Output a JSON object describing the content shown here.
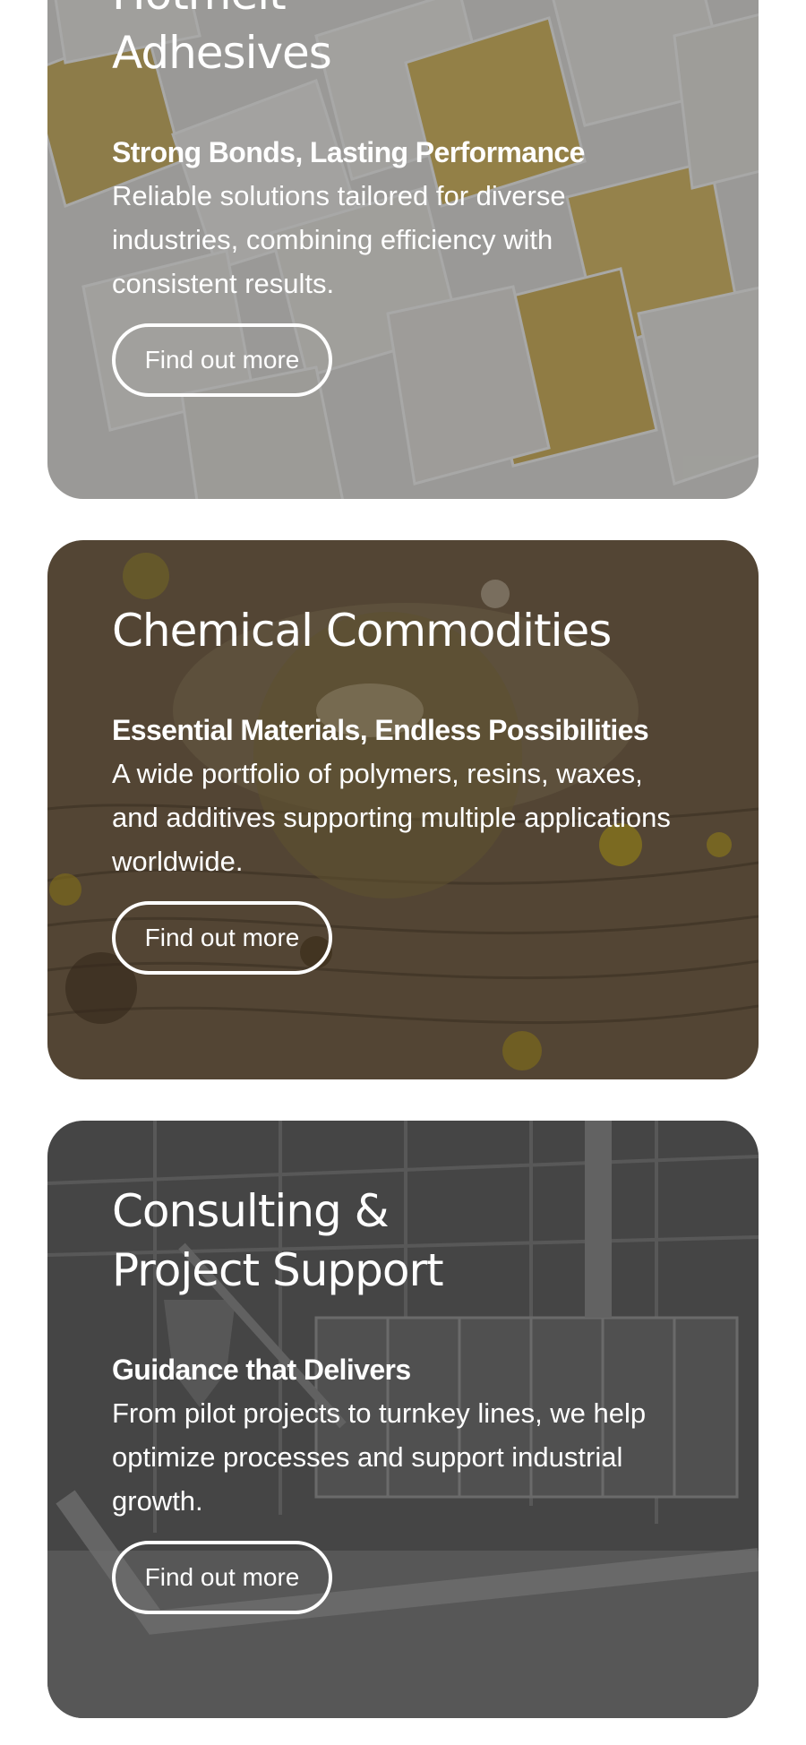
{
  "cards": [
    {
      "title_line1": "Hotmelt",
      "title_line2": "Adhesives",
      "subtitle": "Strong Bonds, Lasting Performance",
      "description": "Reliable solutions tailored for diverse industries, combining efficiency with consistent results.",
      "cta_label": "Find out more",
      "image": "hotmelt-adhesive-pillows-image"
    },
    {
      "title_line1": "Chemical Commodities",
      "subtitle": "Essential Materials, Endless Possibilities",
      "description": "A wide portfolio of polymers, resins, waxes, and additives supporting multiple applications worldwide.",
      "cta_label": "Find out more",
      "image": "resin-drops-on-wood-image"
    },
    {
      "title_line1": "Consulting &",
      "title_line2": "Project Support",
      "subtitle": "Guidance that Delivers",
      "description": "From pilot projects to turnkey lines, we help optimize processes and support industrial growth.",
      "cta_label": "Find out more",
      "image": "industrial-production-line-image"
    }
  ],
  "colors": {
    "card_text": "#ffffff",
    "button_border": "#ffffff",
    "page_background": "#ffffff"
  }
}
